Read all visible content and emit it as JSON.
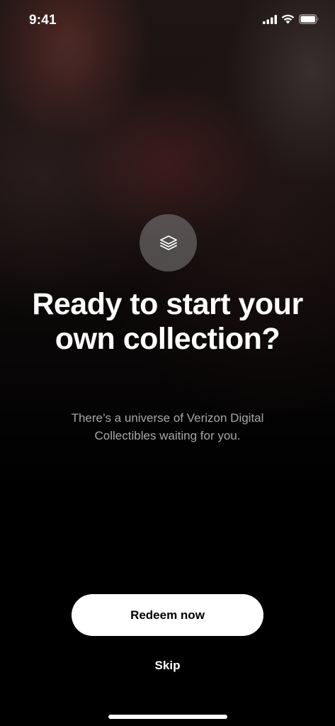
{
  "status_bar": {
    "time": "9:41",
    "icons": [
      "cellular-signal-icon",
      "wifi-icon",
      "battery-icon"
    ]
  },
  "hero": {
    "icon": "layers-stack-icon",
    "headline": "Ready to start your own collection?",
    "subtext": "There’s a universe of Verizon Digital Collectibles waiting for you."
  },
  "actions": {
    "primary_label": "Redeem now",
    "secondary_label": "Skip"
  },
  "colors": {
    "background": "#000000",
    "primary_button_bg": "#ffffff",
    "primary_button_text": "#000000",
    "subtext": "#a7a7a7"
  }
}
